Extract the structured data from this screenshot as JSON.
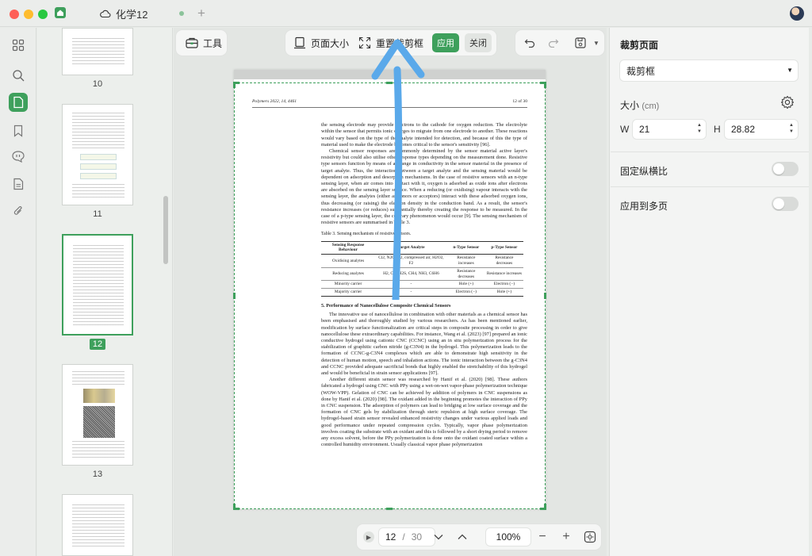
{
  "window": {
    "tab_title": "化学12"
  },
  "toolbar": {
    "tools_label": "工具",
    "page_size_label": "页面大小",
    "reset_crop_label": "重置裁剪框",
    "apply_label": "应用",
    "close_label": "关闭"
  },
  "thumbnails": [
    {
      "label": "10",
      "selected": false
    },
    {
      "label": "11",
      "selected": false
    },
    {
      "label": "12",
      "selected": true
    },
    {
      "label": "13",
      "selected": false
    }
  ],
  "document": {
    "header_left": "Polymers 2022, 14, 4461",
    "header_right": "12 of 30",
    "para1": "the sensing electrode may provide electrons to the cathode for oxygen reduction. The electrolyte within the sensor that permits ionic charges to migrate from one electrode to another. These reactions would vary based on the type of the analyte intended for detection, and because of this the type of material used to make the electrode becomes critical to the sensor's sensitivity [96].",
    "para2": "Chemical sensor responses are commonly determined by the sensor material active layer's resistivity but could also utilise other response types depending on the measurement done. Resistive type sensors function by means of a change in conductivity in the sensor material in the presence of target analyte. Thus, the interaction between a target analyte and the sensing material would be dependent on adsorption and desorption mechanisms. In the case of resistive sensors with an n-type sensing layer, when air comes into contact with it, oxygen is adsorbed as oxide ions after electrons are absorbed on the sensing layer surface. When a reducing (or oxidising) vapour interacts with the sensing layer, the analytes (either as donors or acceptors) interact with these adsorbed oxygen ions, thus decreasing (or raising) the electron density in the conduction band. As a result, the sensor's resistance increases (or reduces) substantially thereby creating the response to be measured. In the case of a p-type sensing layer, the contrary phenomenon would occur [9]. The sensing mechanism of resistive sensors are summarised in Table 3.",
    "table_caption": "Table 3. Sensing mechanism of resistive sensors.",
    "table_headers": [
      "Sensing Response Behaviour",
      "Target Analyte",
      "n-Type Sensor",
      "p-Type Sensor"
    ],
    "table_rows": [
      [
        "Oxidising analytes",
        "Cl2, N2O, O2, compressed air, H2O2, F2",
        "Resistance increases",
        "Resistance decreases"
      ],
      [
        "Reducing analytes",
        "H2, CO, H2S, CH4, NH3, C6H6",
        "Resistance decreases",
        "Resistance increases"
      ],
      [
        "Minority carrier",
        "-",
        "Hole (+)",
        "Electron (−)"
      ],
      [
        "Majority carrier",
        "-",
        "Electron (−)",
        "Hole (+)"
      ]
    ],
    "section_title": "5. Performance of Nanocellulose Composite Chemical Sensors",
    "para3": "The innovative use of nanocellulose in combination with other materials as a chemical sensor has been emphasised and thoroughly studied by various researchers. As has been mentioned earlier, modification by surface functionalization are critical steps in composite processing in order to give nanocellulose these extraordinary capabilities. For instance, Wang et al. (2023) [97] prepared an ionic conductive hydrogel using cationic CNC (CCNC) using an in situ polymerization process for the stabilization of graphitic carbon nitride (g-C3N4) in the hydrogel. This polymerization leads to the formation of CCNC-g-C3N4 complexes which are able to demonstrate high sensitivity in the detection of human motion, speech and inhalation actions. The ionic interaction between the g-C3N4 and CCNC provided adequate sacrificial bonds that highly enabled the stretchability of this hydrogel and would be beneficial in strain sensor applications [97].",
    "para4": "Another different strain sensor was researched by Hanif et al. (2020) [98]. These authors fabricated a hydrogel using CNC with PPy using a wet-on-wet vapor-phase polymerization technique (WOW-VPP). Gelation of CNC can be achieved by addition of polymers in CNC suspensions as done by Hanif et al. (2020) [98]. The oxidant added in the beginning promotes the interaction of PPy in CNC suspension. The adsorption of polymers can lead to bridging at low surface coverage and the formation of CNC gels by stabilization through steric repulsion at high surface coverage. The hydrogel-based strain sensor revealed enhanced resistivity changes under various applied loads and good performance under repeated compression cycles. Typically, vapor phase polymerization involves coating the substrate with an oxidant and this is followed by a short drying period to remove any excess solvent, before the PPy polymerization is done onto the oxidant coated surface within a controlled humidity environment. Usually classical vapor phase polymerization"
  },
  "navigation": {
    "current_page": "12",
    "separator": "/",
    "total_pages": "30",
    "zoom": "100%"
  },
  "right_panel": {
    "title": "裁剪页面",
    "crop_mode": "裁剪框",
    "size_label": "大小",
    "size_unit": "(cm)",
    "width_label": "W",
    "width_value": "21",
    "height_label": "H",
    "height_value": "28.82",
    "lock_ratio_label": "固定纵横比",
    "lock_ratio_on": false,
    "apply_multi_label": "应用到多页",
    "apply_multi_on": false
  },
  "colors": {
    "accent": "#3ea05c",
    "arrow": "#5aa9ea"
  }
}
